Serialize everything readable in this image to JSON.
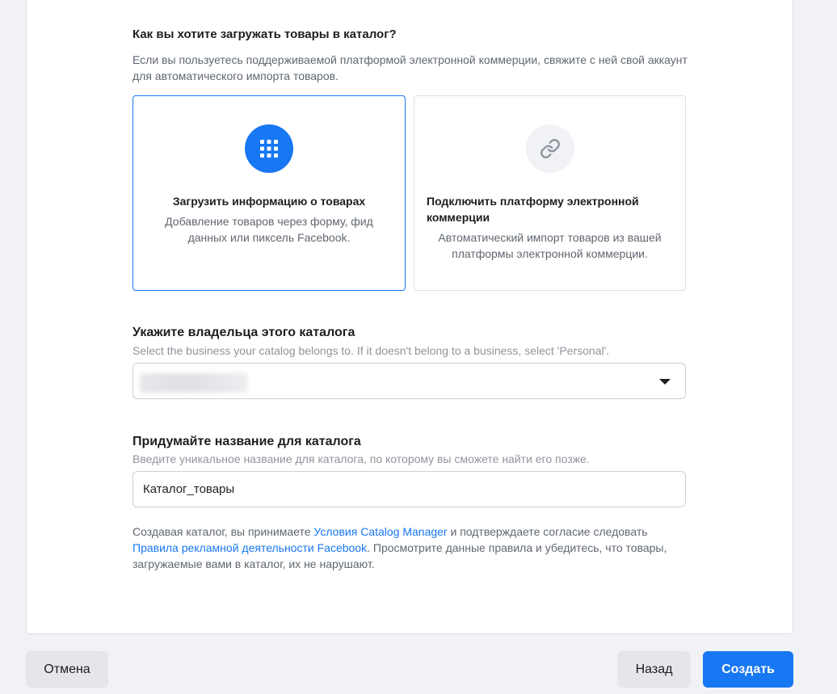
{
  "upload": {
    "title": "Как вы хотите загружать товары в каталог?",
    "description": "Если вы пользуетесь поддерживаемой платформой электронной коммерции, свяжите с ней свой аккаунт для автоматического импорта товаров.",
    "options": [
      {
        "title": "Загрузить информацию о товарах",
        "description": "Добавление товаров через форму, фид данных или пиксель Facebook.",
        "icon": "grid-icon",
        "selected": true
      },
      {
        "title": "Подключить платформу электронной коммерции",
        "description": "Автоматический импорт товаров из вашей платформы электронной коммерции.",
        "icon": "link-icon",
        "selected": false
      }
    ]
  },
  "owner": {
    "label": "Укажите владельца этого каталога",
    "hint": "Select the business your catalog belongs to. If it doesn't belong to a business, select 'Personal'."
  },
  "catalog_name": {
    "label": "Придумайте название для каталога",
    "hint": "Введите уникальное название для каталога, по которому вы сможете найти его позже.",
    "value": "Каталог_товары"
  },
  "terms": {
    "part1": "Создавая каталог, вы принимаете ",
    "link1": "Условия Catalog Manager",
    "part2": " и подтверждаете согласие следовать ",
    "link2": "Правила рекламной деятельности Facebook",
    "part3": ". Просмотрите данные правила и убедитесь, что товары, загружаемые вами в каталог, их не нарушают."
  },
  "buttons": {
    "cancel": "Отмена",
    "back": "Назад",
    "create": "Создать"
  },
  "colors": {
    "accent": "#1877f2",
    "background": "#f0f2f5"
  }
}
